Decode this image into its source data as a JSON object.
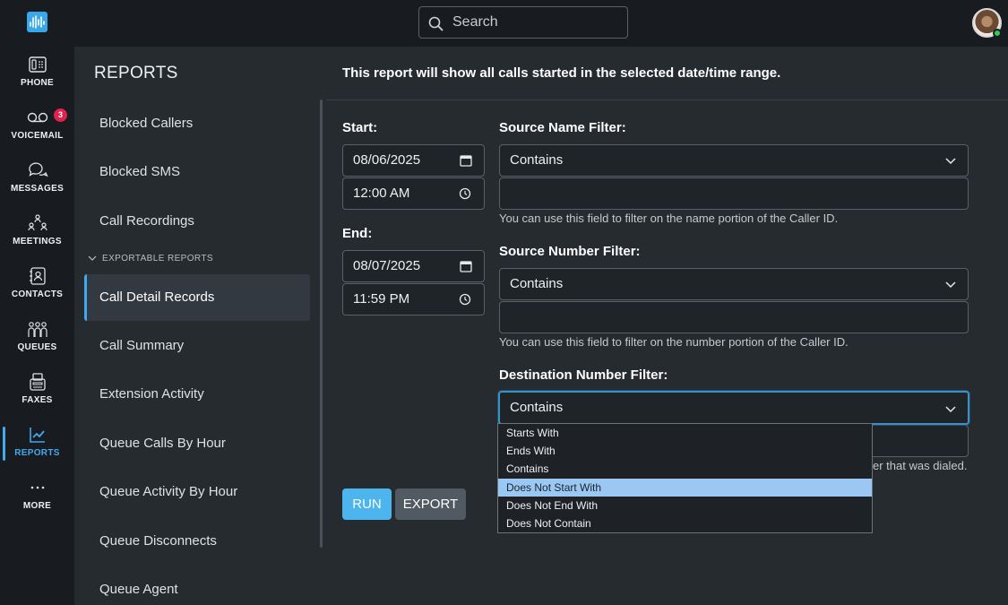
{
  "nav": {
    "items": [
      {
        "label": "PHONE",
        "icon": "phone-icon"
      },
      {
        "label": "VOICEMAIL",
        "icon": "voicemail-icon",
        "badge": "3"
      },
      {
        "label": "MESSAGES",
        "icon": "messages-icon"
      },
      {
        "label": "MEETINGS",
        "icon": "meetings-icon"
      },
      {
        "label": "CONTACTS",
        "icon": "contacts-icon"
      },
      {
        "label": "QUEUES",
        "icon": "queues-icon"
      },
      {
        "label": "FAXES",
        "icon": "fax-icon"
      },
      {
        "label": "REPORTS",
        "icon": "reports-icon",
        "active": true
      },
      {
        "label": "MORE",
        "icon": "more-icon"
      }
    ],
    "accent_color": "#41a9f0",
    "badge_color": "#e0224f"
  },
  "search": {
    "placeholder": "Search"
  },
  "reports_menu": {
    "title": "REPORTS",
    "items": [
      "Blocked Callers",
      "Blocked SMS",
      "Call Recordings"
    ],
    "section_label": "EXPORTABLE REPORTS",
    "exportable_items": [
      "Call Detail Records",
      "Call Summary",
      "Extension Activity",
      "Queue Calls By Hour",
      "Queue Activity By Hour",
      "Queue Disconnects",
      "Queue Agent"
    ],
    "active_item": "Call Detail Records"
  },
  "form": {
    "intro": "This report will show all calls started in the selected date/time range.",
    "start_label": "Start:",
    "start_date": "08/06/2025",
    "start_time": "12:00  AM",
    "end_label": "End:",
    "end_date": "08/07/2025",
    "end_time": "11:59  PM",
    "source_name": {
      "label": "Source Name Filter:",
      "mode": "Contains",
      "value": "",
      "hint": "You can use this field to filter on the name portion of the Caller ID."
    },
    "source_number": {
      "label": "Source Number Filter:",
      "mode": "Contains",
      "value": "",
      "hint": "You can use this field to filter on the number portion of the Caller ID."
    },
    "destination_number": {
      "label": "Destination Number Filter:",
      "mode": "Contains",
      "value": "",
      "hint_visible": "er that was dialed."
    },
    "run_label": "RUN",
    "export_label": "EXPORT"
  },
  "dropdown": {
    "options": [
      "Starts With",
      "Ends With",
      "Contains",
      "Does Not Start With",
      "Does Not End With",
      "Does Not Contain"
    ],
    "highlighted": "Does Not Start With"
  }
}
